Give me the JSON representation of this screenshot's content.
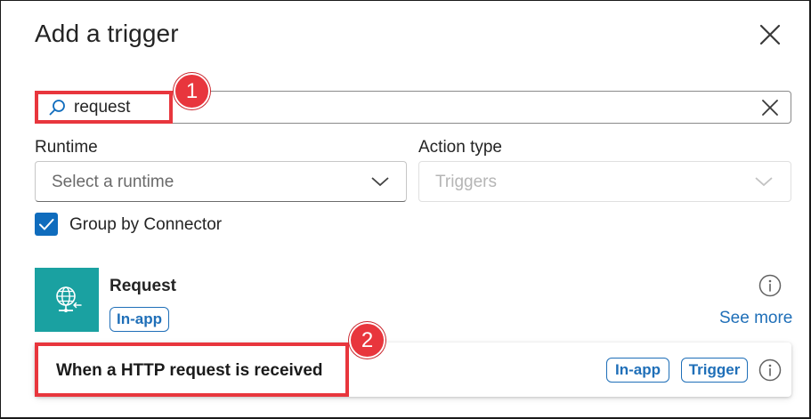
{
  "dialog": {
    "title": "Add a trigger"
  },
  "search": {
    "value": "request"
  },
  "filters": {
    "runtime_label": "Runtime",
    "runtime_placeholder": "Select a runtime",
    "action_type_label": "Action type",
    "action_type_value": "Triggers"
  },
  "group_by_connector": {
    "label": "Group by Connector",
    "checked": true
  },
  "connector": {
    "name": "Request",
    "badge": "In-app",
    "see_more": "See more",
    "icon": "globe-network-icon",
    "icon_bg": "#1aa1a1"
  },
  "triggers": [
    {
      "name": "When a HTTP request is received",
      "badges": [
        "In-app",
        "Trigger"
      ]
    }
  ],
  "callouts": [
    {
      "number": "1"
    },
    {
      "number": "2"
    }
  ],
  "colors": {
    "accent": "#0f6cbd",
    "link": "#1f6fb8",
    "callout": "#e8363d"
  }
}
